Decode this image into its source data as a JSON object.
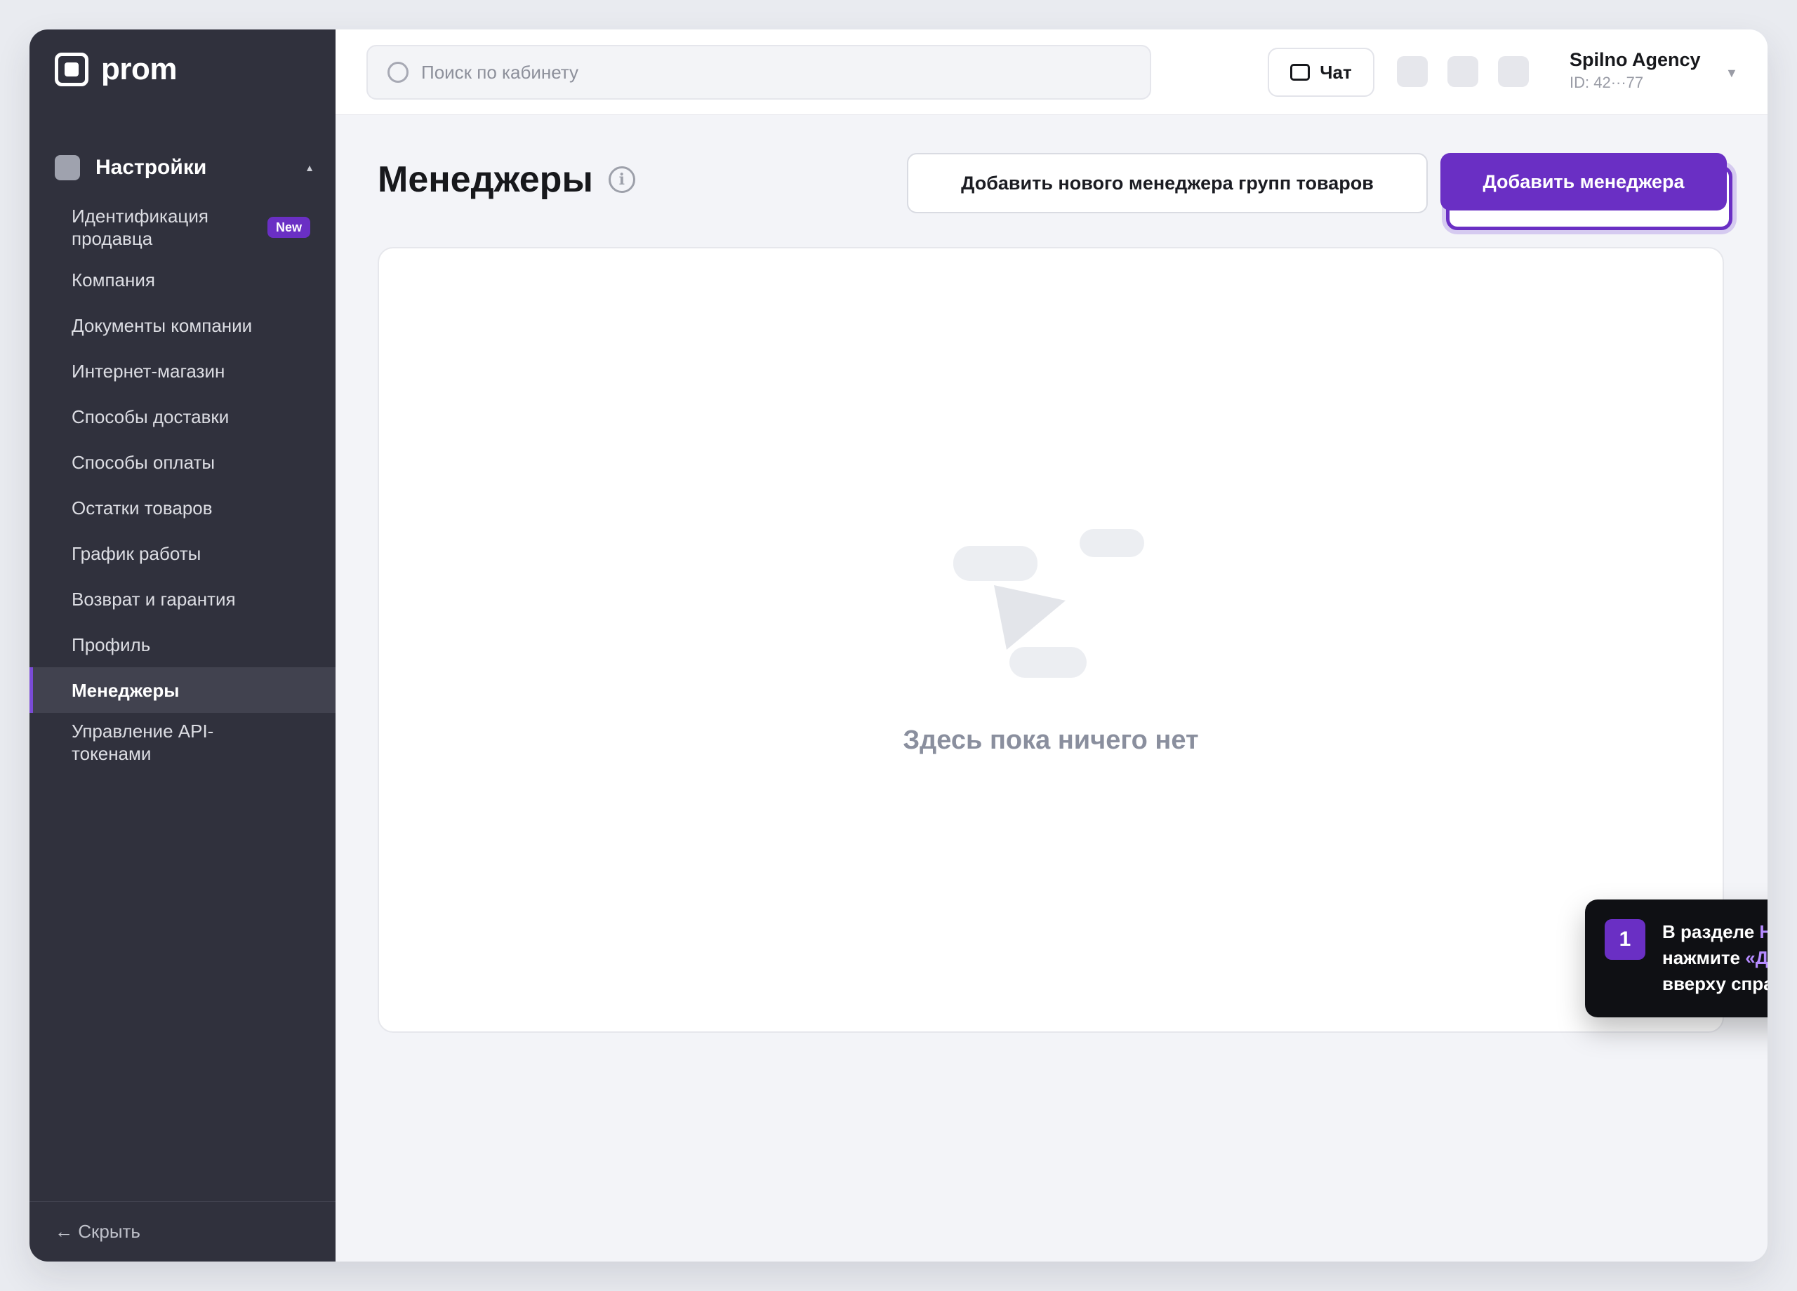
{
  "app": {
    "logo": "prom"
  },
  "sidebar": {
    "section_title": "Настройки",
    "items": [
      {
        "label": "Идентификация продавца",
        "badge": "New"
      },
      {
        "label": "Компания"
      },
      {
        "label": "Документы компании"
      },
      {
        "label": "Интернет-магазин"
      },
      {
        "label": "Способы доставки"
      },
      {
        "label": "Способы оплаты"
      },
      {
        "label": "Остатки товаров"
      },
      {
        "label": "График работы"
      },
      {
        "label": "Возврат и гарантия"
      },
      {
        "label": "Профиль"
      },
      {
        "label": "Менеджеры",
        "active": true
      },
      {
        "label": "Управление API-токенами"
      }
    ],
    "hide_label": "← Скрыть"
  },
  "topbar": {
    "search_placeholder": "Поиск по кабинету",
    "chat_label": "Чат",
    "account_name": "Spilno Agency",
    "account_id": "ID: 42···77"
  },
  "page": {
    "title": "Менеджеры",
    "info_glyph": "i",
    "secondary_button": "Добавить нового менеджера групп товаров",
    "primary_button": "Добавить менеджера",
    "empty_state": "Здесь пока ничего нет"
  },
  "tooltip": {
    "step": "1",
    "text_1": "В разделе ",
    "highlight_1": "Настройки → Менеджеры",
    "text_2": "нажмите ",
    "highlight_2": "«Добавить менеджера»",
    "text_3": "вверху справа."
  },
  "colors": {
    "sidebar_bg": "#30313d",
    "accent": "#6a2fc4",
    "highlight_text": "#b58bff"
  }
}
